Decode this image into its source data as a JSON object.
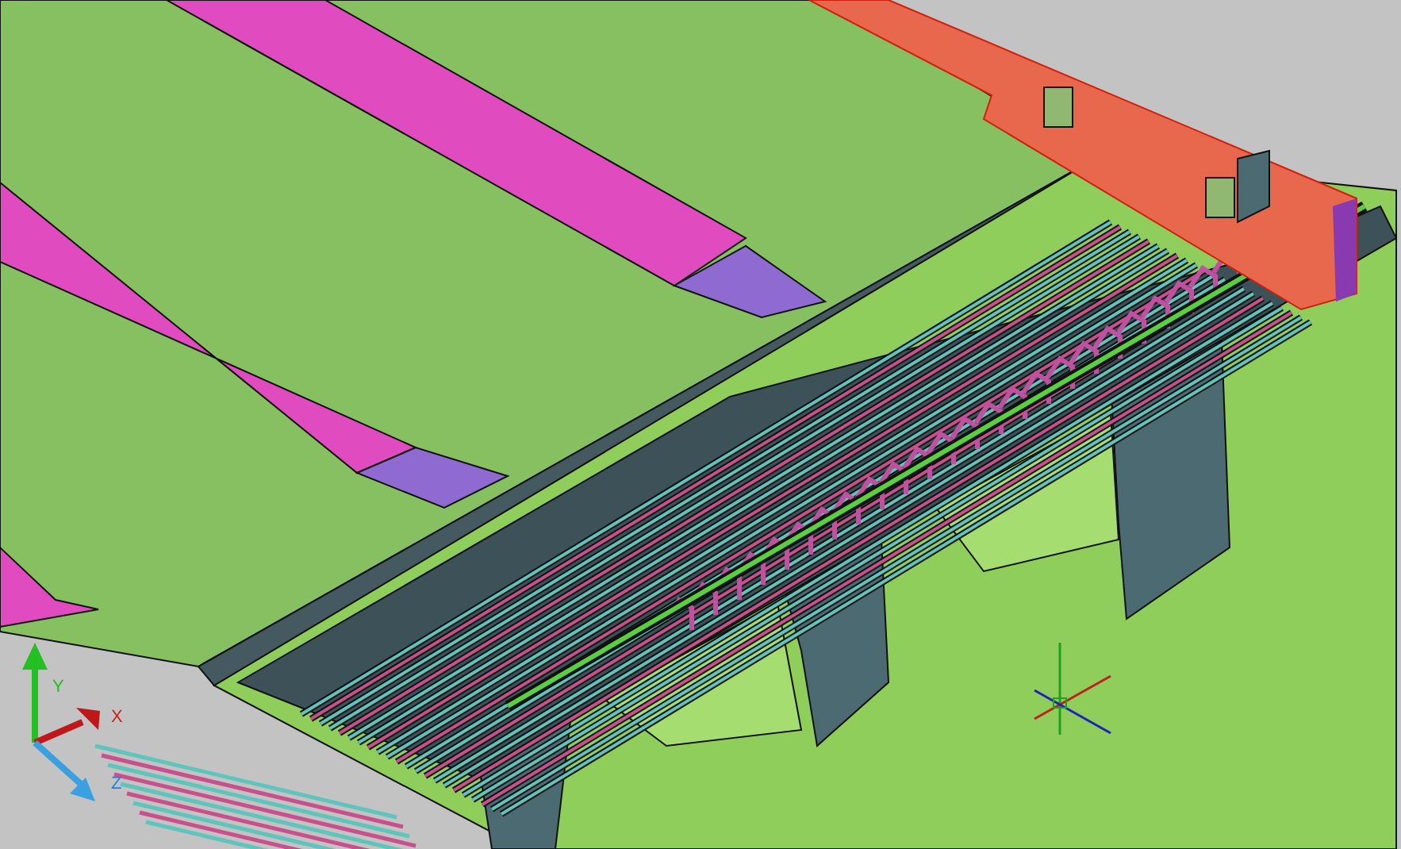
{
  "viewport": {
    "ucs_axis_labels": [
      "Y",
      "X",
      "Z"
    ]
  }
}
